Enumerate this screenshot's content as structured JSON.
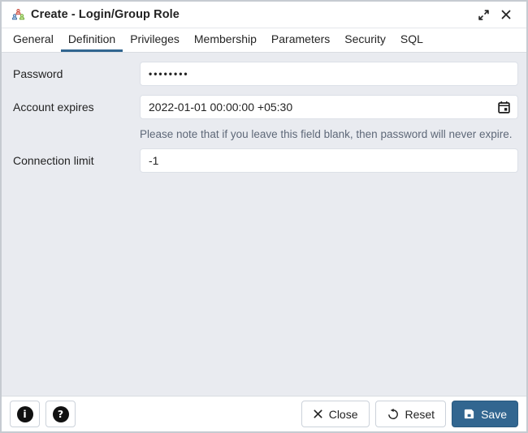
{
  "window": {
    "title": "Create - Login/Group Role"
  },
  "tabs": [
    "General",
    "Definition",
    "Privileges",
    "Membership",
    "Parameters",
    "Security",
    "SQL"
  ],
  "active_tab": "Definition",
  "form": {
    "password": {
      "label": "Password",
      "value": "••••••••"
    },
    "account_expires": {
      "label": "Account expires",
      "value": "2022-01-01 00:00:00 +05:30"
    },
    "account_expires_note": "Please note that if you leave this field blank, then password will never expire.",
    "connection_limit": {
      "label": "Connection limit",
      "value": "-1"
    }
  },
  "footer": {
    "info_glyph": "i",
    "help_glyph": "?",
    "close_label": "Close",
    "reset_label": "Reset",
    "save_label": "Save"
  },
  "colors": {
    "accent": "#326690",
    "body_background": "#e9ebf0",
    "note_text": "#5e6878"
  }
}
